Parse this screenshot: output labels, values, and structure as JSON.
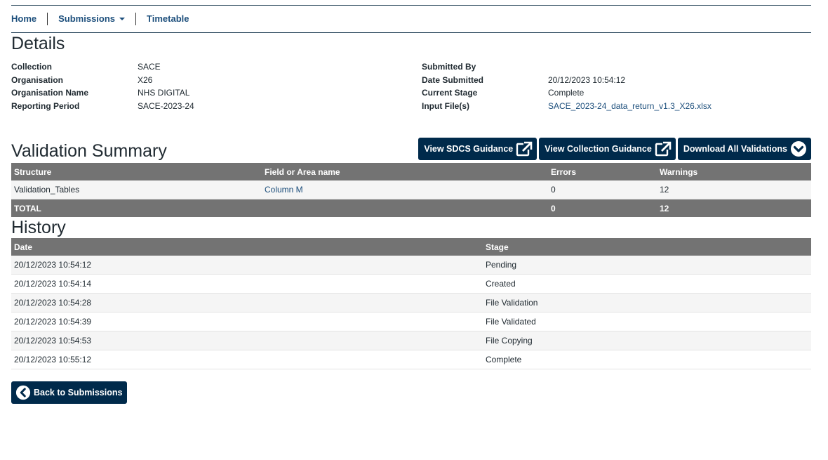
{
  "nav": {
    "home": "Home",
    "submissions": "Submissions",
    "timetable": "Timetable"
  },
  "details": {
    "title": "Details",
    "left": [
      {
        "label": "Collection",
        "value": "SACE"
      },
      {
        "label": "Organisation",
        "value": "X26"
      },
      {
        "label": "Organisation Name",
        "value": "NHS DIGITAL"
      },
      {
        "label": "Reporting Period",
        "value": "SACE-2023-24"
      }
    ],
    "right": [
      {
        "label": "Submitted By",
        "value": ""
      },
      {
        "label": "Date Submitted",
        "value": "20/12/2023 10:54:12"
      },
      {
        "label": "Current Stage",
        "value": "Complete"
      },
      {
        "label": "Input File(s)",
        "value": "SACE_2023-24_data_return_v1.3_X26.xlsx"
      }
    ]
  },
  "validation": {
    "title": "Validation Summary",
    "buttons": {
      "sdcs": "View SDCS Guidance",
      "collection": "View Collection Guidance",
      "download": "Download All Validations"
    },
    "columns": [
      "Structure",
      "Field or Area name",
      "Errors",
      "Warnings"
    ],
    "rows": [
      {
        "structure": "Validation_Tables",
        "field": "Column M",
        "errors": "0",
        "warnings": "12"
      }
    ],
    "total": {
      "label": "TOTAL",
      "errors": "0",
      "warnings": "12"
    }
  },
  "history": {
    "title": "History",
    "columns": [
      "Date",
      "Stage"
    ],
    "rows": [
      {
        "date": "20/12/2023 10:54:12",
        "stage": "Pending"
      },
      {
        "date": "20/12/2023 10:54:14",
        "stage": "Created"
      },
      {
        "date": "20/12/2023 10:54:28",
        "stage": "File Validation"
      },
      {
        "date": "20/12/2023 10:54:39",
        "stage": "File Validated"
      },
      {
        "date": "20/12/2023 10:54:53",
        "stage": "File Copying"
      },
      {
        "date": "20/12/2023 10:55:12",
        "stage": "Complete"
      }
    ]
  },
  "back_button": "Back to Submissions",
  "colors": {
    "primary": "#002a4b",
    "link": "#1d4f7c",
    "table_header": "#737373"
  }
}
